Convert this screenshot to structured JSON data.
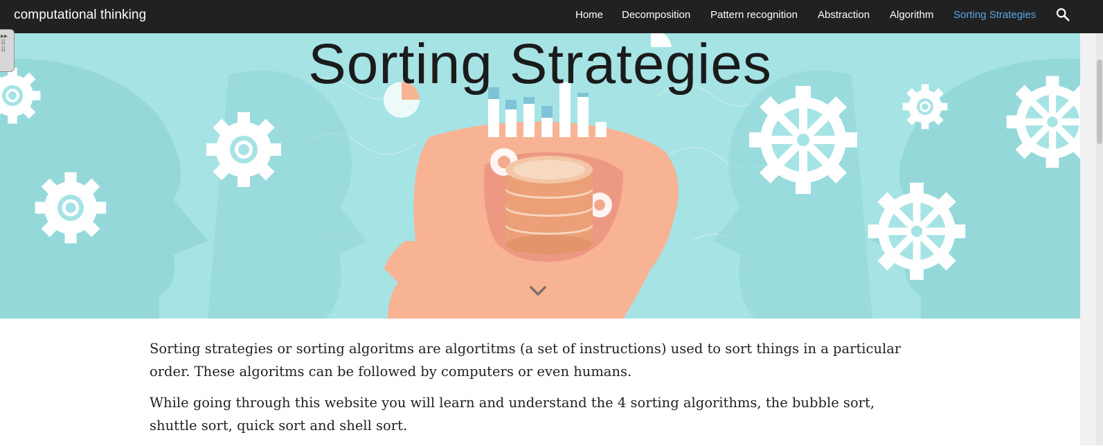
{
  "site": {
    "title": "computational thinking"
  },
  "nav": {
    "items": [
      {
        "label": "Home",
        "active": false
      },
      {
        "label": "Decomposition",
        "active": false
      },
      {
        "label": "Pattern recognition",
        "active": false
      },
      {
        "label": "Abstraction",
        "active": false
      },
      {
        "label": "Algorithm",
        "active": false
      },
      {
        "label": "Sorting Strategies",
        "active": true
      }
    ],
    "search_icon": "search-icon"
  },
  "hero": {
    "title": "Sorting Strategies",
    "scroll_icon": "chevron-down-icon"
  },
  "content": {
    "paragraphs": [
      "Sorting strategies or sorting algoritms are algortitms (a set of instructions) used to sort things in a particular order. These algoritms can be followed by computers or even humans.",
      "While going through this website you will learn and understand the 4 sorting algorithms, the bubble sort, shuttle sort, quick sort and shell sort."
    ]
  },
  "colors": {
    "topbar": "#212121",
    "active_link": "#5aa7e6",
    "hero_bg": "#a6e3e5",
    "head_fill": "#f7b394"
  }
}
